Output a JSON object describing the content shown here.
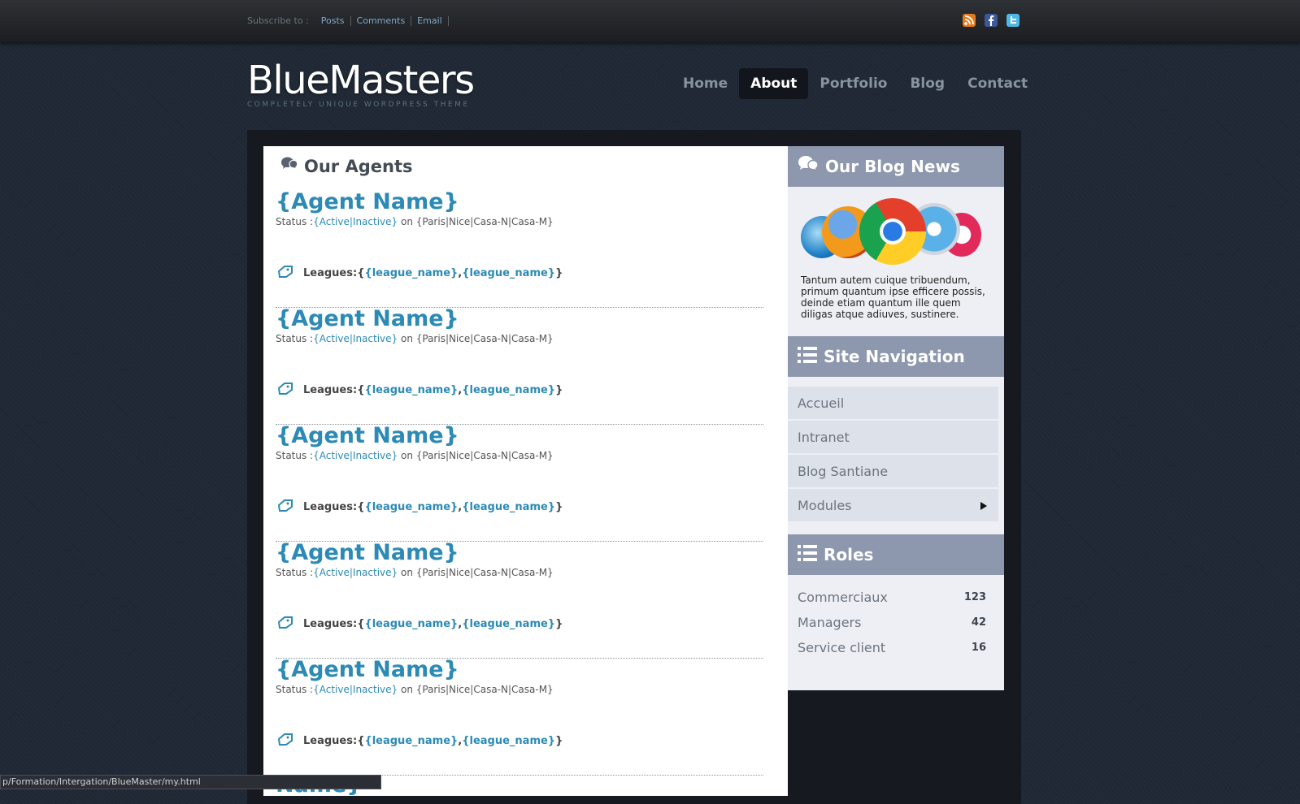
{
  "topbar": {
    "subscribe_label": "Subscribe to :",
    "links": [
      "Posts",
      "Comments",
      "Email"
    ],
    "social": [
      "rss-icon",
      "facebook-icon",
      "twitter-icon"
    ]
  },
  "logo": {
    "name": "BlueMasters",
    "tagline": "COMPLETELY UNIQUE WORDPRESS THEME"
  },
  "nav": {
    "items": [
      "Home",
      "About",
      "Portfolio",
      "Blog",
      "Contact"
    ],
    "active": "About"
  },
  "main": {
    "title": "Our Agents",
    "agents": [
      {
        "name": "{Agent Name}",
        "status_label": "Status :",
        "status_value": "{Active|Inactive}",
        "on": " on ",
        "location": "{Paris|Nice|Casa-N|Casa-M}",
        "leagues_label": "Leagues: ",
        "leagues_open": "{",
        "league_1": "{league_name}",
        "sep": ",",
        "league_2": "{league_name}",
        "leagues_close": "}"
      },
      {
        "name": "{Agent Name}",
        "status_label": "Status :",
        "status_value": "{Active|Inactive}",
        "on": " on ",
        "location": "{Paris|Nice|Casa-N|Casa-M}",
        "leagues_label": "Leagues: ",
        "leagues_open": "{",
        "league_1": "{league_name}",
        "sep": ",",
        "league_2": "{league_name}",
        "leagues_close": "}"
      },
      {
        "name": "{Agent Name}",
        "status_label": "Status :",
        "status_value": "{Active|Inactive}",
        "on": " on ",
        "location": "{Paris|Nice|Casa-N|Casa-M}",
        "leagues_label": "Leagues: ",
        "leagues_open": "{",
        "league_1": "{league_name}",
        "sep": ",",
        "league_2": "{league_name}",
        "leagues_close": "}"
      },
      {
        "name": "{Agent Name}",
        "status_label": "Status :",
        "status_value": "{Active|Inactive}",
        "on": " on ",
        "location": "{Paris|Nice|Casa-N|Casa-M}",
        "leagues_label": "Leagues: ",
        "leagues_open": "{",
        "league_1": "{league_name}",
        "sep": ",",
        "league_2": "{league_name}",
        "leagues_close": "}"
      },
      {
        "name": "{Agent Name}",
        "status_label": "Status :",
        "status_value": "{Active|Inactive}",
        "on": " on ",
        "location": "{Paris|Nice|Casa-N|Casa-M}",
        "leagues_label": "Leagues: ",
        "leagues_open": "{",
        "league_1": "{league_name}",
        "sep": ",",
        "league_2": "{league_name}",
        "leagues_close": "}"
      }
    ],
    "partial_title": "Name}"
  },
  "sidebar": {
    "blog_news": {
      "title": "Our Blog News",
      "text": "Tantum autem cuique tribuendum, primum quantum ipse efficere possis, deinde etiam quantum ille quem diligas atque adiuves, sustinere."
    },
    "site_nav": {
      "title": "Site Navigation",
      "items": [
        "Accueil",
        "Intranet",
        "Blog Santiane",
        "Modules"
      ]
    },
    "roles": {
      "title": "Roles",
      "items": [
        {
          "label": "Commerciaux",
          "count": "123"
        },
        {
          "label": "Managers",
          "count": "42"
        },
        {
          "label": "Service client",
          "count": "16"
        }
      ]
    }
  },
  "statusbar": {
    "url": "p/Formation/Intergation/BlueMaster/my.html"
  },
  "colors": {
    "accent": "#2c8ab5",
    "sidebar_head": "#8d97ad",
    "background": "#1e2733"
  }
}
